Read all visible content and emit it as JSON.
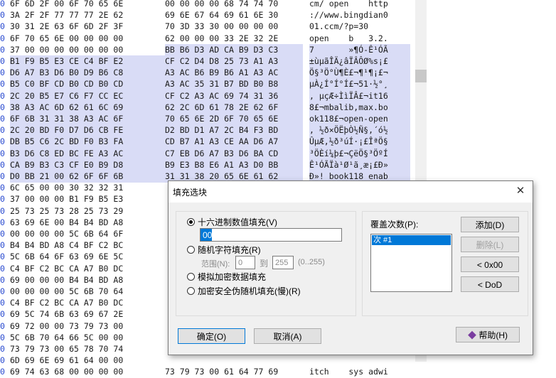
{
  "hex_rows": [
    {
      "off": "0",
      "h1": "6F 6D 2F 00 6F 70 65 6E",
      "h2": "00 00 00 00 68 74 74 70",
      "asc": "cm/ open    http"
    },
    {
      "off": "0",
      "h1": "3A 2F 2F 77 77 77 2E 62",
      "h2": "69 6E 67 64 69 61 6E 30",
      "asc": "://www.bingdian0"
    },
    {
      "off": "0",
      "h1": "30 31 2E 63 6F 6D 2F 3F",
      "h2": "70 3D 33 30 00 00 00 00",
      "asc": "01.ccm/?p=30"
    },
    {
      "off": "0",
      "h1": "6F 70 65 6E 00 00 00 00",
      "h2": "62 00 00 00 33 2E 32 2E",
      "asc": "open    b   3.2."
    },
    {
      "off": "0",
      "h1": "37 00 00 00 00 00 00 00",
      "h2": "BB B6 D3 AD CA B9 D3 C3",
      "asc": "7       »¶Ó-Ê¹ÓÃ"
    },
    {
      "off": "0",
      "h1": "B1 F9 B5 E3 CE C4 BF E2",
      "h2": "CF C2 D4 D8 25 73 A1 A3",
      "asc": "±ùµãÎÄ¿âÏÂÔØ%s¡£"
    },
    {
      "off": "0",
      "h1": "D6 A7 B3 D6 B0 D9 B6 C8",
      "h2": "A3 AC B6 B9 B6 A1 A3 AC",
      "asc": "Ö§³Ö°Ù¶È£¬¶¹¶¡£¬"
    },
    {
      "off": "0",
      "h1": "B5 C0 BF CD B0 CD B0 CD",
      "h2": "A3 AC 35 31 B7 BD B0 B8",
      "asc": "µÀ¿Í°Í°Í£¬51·½°¸"
    },
    {
      "off": "0",
      "h1": "2C 20 B5 E7 C6 F7 CC EC",
      "h2": "CF C2 A3 AC 69 74 31 36",
      "asc": ", µçÆ÷ÌìÏÂ£¬it16"
    },
    {
      "off": "0",
      "h1": "38 A3 AC 6D 62 61 6C 69",
      "h2": "62 2C 6D 61 78 2E 62 6F",
      "asc": "8£¬mbalib,max.bo"
    },
    {
      "off": "0",
      "h1": "6F 6B 31 31 38 A3 AC 6F",
      "h2": "70 65 6E 2D 6F 70 65 6E",
      "asc": "ok118£¬open-open"
    },
    {
      "off": "0",
      "h1": "2C 20 BD F0 D7 D6 CB FE",
      "h2": "D2 BD D1 A7 2C B4 F3 BD",
      "asc": ", ½ð×ÖËþÒ½Ñ§,´ó½"
    },
    {
      "off": "0",
      "h1": "DB B5 C6 2C BD F0 B3 FA",
      "h2": "CD B7 A1 A3 CE AA D6 A7",
      "asc": "ÛµÆ,½ð³úÍ·¡£ÎªÖ§"
    },
    {
      "off": "0",
      "h1": "B3 D6 C8 ED BC FE A3 AC",
      "h2": "C7 EB D6 A7 B3 D6 BA CD",
      "asc": "³ÖÈí¼þ£¬ÇëÖ§³ÖºÍ"
    },
    {
      "off": "0",
      "h1": "CA B9 B3 C3 CF E0 B9 D8",
      "h2": "B9 E3 B8 E6 A1 A3 D0 BB",
      "asc": "Ê¹ÓÃÏà¹Ø¹ã¸æ¡£Ð»"
    },
    {
      "off": "0",
      "h1": "D0 BB 21 00 62 6F 6F 6B",
      "h2": "31 31 38 20 65 6E 61 62",
      "asc": "Ð»! book118 enab"
    },
    {
      "off": "0",
      "h1": "6C 65 00 00 30 32 32 31",
      "h2": "",
      "asc": ""
    },
    {
      "off": "0",
      "h1": "37 00 00 00 B1 F9 B5 E3",
      "h2": "",
      "asc": ""
    },
    {
      "off": "0",
      "h1": "25 73 25 73 28 25 73 29",
      "h2": "",
      "asc": ""
    },
    {
      "off": "0",
      "h1": "63 69 6E 00 B4 B4 BD A8",
      "h2": "",
      "asc": ""
    },
    {
      "off": "0",
      "h1": "00 00 00 00 5C 6B 64 6F",
      "h2": "",
      "asc": ""
    },
    {
      "off": "0",
      "h1": "B4 B4 BD A8 C4 BF C2 BC",
      "h2": "",
      "asc": ""
    },
    {
      "off": "0",
      "h1": "5C 6B 64 6F 63 69 6E 5C",
      "h2": "",
      "asc": ""
    },
    {
      "off": "0",
      "h1": "C4 BF C2 BC CA A7 B0 DC",
      "h2": "",
      "asc": ""
    },
    {
      "off": "0",
      "h1": "69 00 00 00 B4 B4 BD A8",
      "h2": "",
      "asc": ""
    },
    {
      "off": "0",
      "h1": "00 00 00 00 5C 6B 70 64",
      "h2": "",
      "asc": ""
    },
    {
      "off": "0",
      "h1": "C4 BF C2 BC CA A7 B0 DC",
      "h2": "",
      "asc": ""
    },
    {
      "off": "0",
      "h1": "69 5C 74 6B 63 69 67 2E",
      "h2": "",
      "asc": ""
    },
    {
      "off": "0",
      "h1": "69 72 00 00 73 79 73 00",
      "h2": "",
      "asc": ""
    },
    {
      "off": "0",
      "h1": "5C 6B 70 64 66 5C 00 00",
      "h2": "",
      "asc": ""
    },
    {
      "off": "0",
      "h1": "73 79 73 00 65 78 70 74",
      "h2": "",
      "asc": ""
    },
    {
      "off": "0",
      "h1": "6D 69 6E 69 61 64 00 00",
      "h2": "",
      "asc": ""
    },
    {
      "off": "0",
      "h1": "69 74 63 68 00 00 00 00",
      "h2": "73 79 73 00 61 64 77 69",
      "asc": "itch    sys adwi"
    }
  ],
  "dialog": {
    "title": "填充选块",
    "close_glyph": "✕",
    "radio_hex": "十六进制数值填充(V)",
    "hex_value": "00",
    "radio_random": "随机字符填充(R)",
    "range_label": "范围(N):",
    "range_from": "0",
    "range_to_label": "到",
    "range_to": "255",
    "range_hint": "(0..255)",
    "radio_simulate": "模拟加密数据填充",
    "radio_secure": "加密安全伪随机填充(慢)(R)",
    "overwrite_label": "覆盖次数(P):",
    "overwrite_item": "次 #1",
    "add_button": "添加(D)",
    "delete_button": "删除(L)",
    "zero_button": "< 0x00",
    "dod_button": "< DoD",
    "ok_button": "确定(O)",
    "cancel_button": "取消(A)",
    "help_button": "帮助(H)"
  }
}
